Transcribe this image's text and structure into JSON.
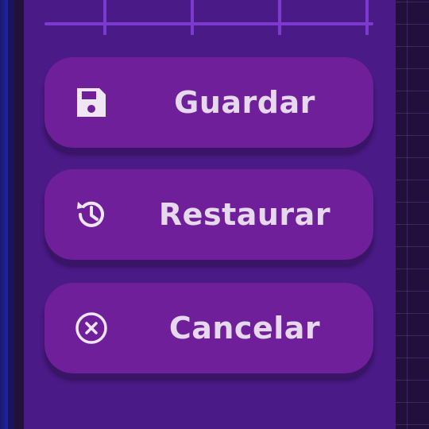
{
  "buttons": {
    "save": {
      "label": "Guardar",
      "icon": "floppy-disk-icon"
    },
    "restore": {
      "label": "Restaurar",
      "icon": "history-icon"
    },
    "cancel": {
      "label": "Cancelar",
      "icon": "close-circle-icon"
    }
  },
  "colors": {
    "panel": "#4a1a86",
    "button": "#6f1f99",
    "text": "#e6d9ee"
  }
}
